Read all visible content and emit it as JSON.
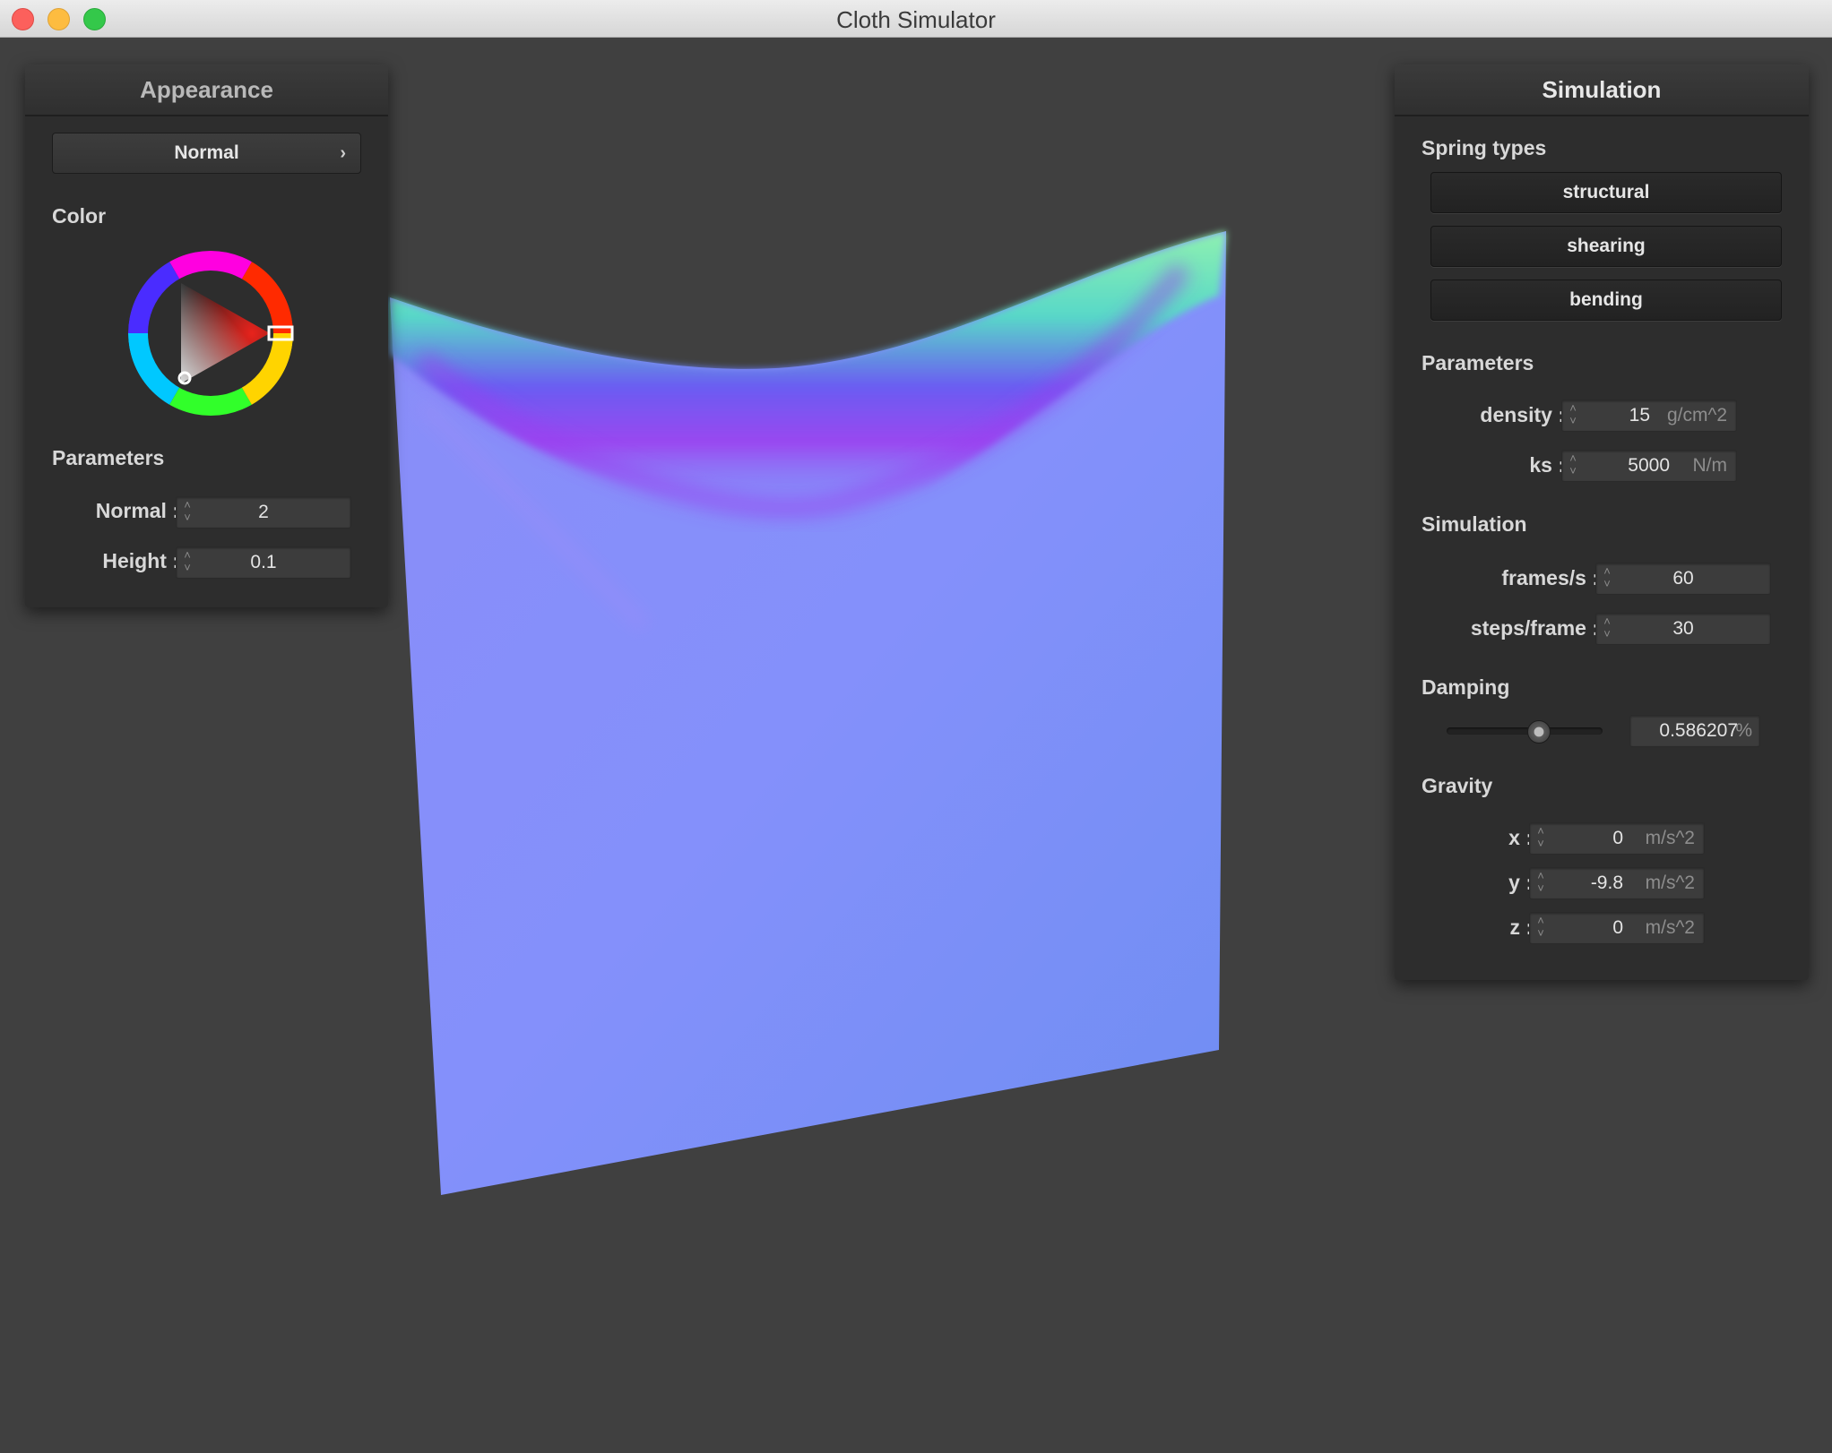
{
  "window": {
    "title": "Cloth Simulator"
  },
  "appearance": {
    "title": "Appearance",
    "shader_select": "Normal",
    "color_section": "Color",
    "selected_color": "#e8231c",
    "parameters_section": "Parameters",
    "normal_label": "Normal :",
    "normal_value": "2",
    "height_label": "Height :",
    "height_value": "0.1"
  },
  "simulation": {
    "title": "Simulation",
    "spring_types_section": "Spring types",
    "spring_buttons": [
      "structural",
      "shearing",
      "bending"
    ],
    "parameters_section": "Parameters",
    "density_label": "density :",
    "density_value": "15",
    "density_unit": "g/cm^2",
    "ks_label": "ks :",
    "ks_value": "5000",
    "ks_unit": "N/m",
    "sim_section": "Simulation",
    "fps_label": "frames/s :",
    "fps_value": "60",
    "steps_label": "steps/frame :",
    "steps_value": "30",
    "damping_section": "Damping",
    "damping_value": "0.586207",
    "damping_unit": "%",
    "damping_slider_fraction": 0.586,
    "gravity_section": "Gravity",
    "gravity_x_label": "x :",
    "gravity_x_value": "0",
    "gravity_y_label": "y :",
    "gravity_y_value": "-9.8",
    "gravity_z_label": "z :",
    "gravity_z_value": "0",
    "gravity_unit": "m/s^2"
  },
  "colors": {
    "background": "#404040",
    "panel": "#2d2d2d",
    "cloth_base": "#7f8cf8"
  }
}
